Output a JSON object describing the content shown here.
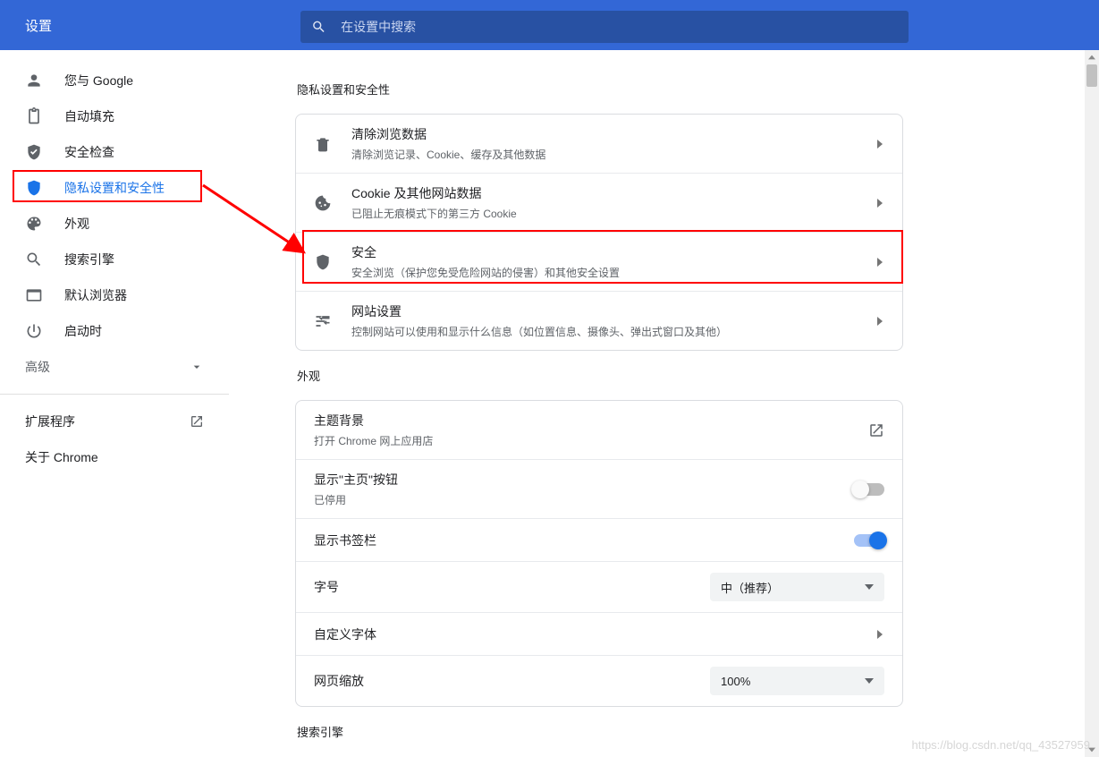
{
  "header": {
    "title": "设置"
  },
  "search": {
    "placeholder": "在设置中搜索"
  },
  "sidebar": {
    "items": [
      {
        "label": "您与 Google"
      },
      {
        "label": "自动填充"
      },
      {
        "label": "安全检查"
      },
      {
        "label": "隐私设置和安全性"
      },
      {
        "label": "外观"
      },
      {
        "label": "搜索引擎"
      },
      {
        "label": "默认浏览器"
      },
      {
        "label": "启动时"
      }
    ],
    "advanced": "高级",
    "extensions": "扩展程序",
    "about": "关于 Chrome"
  },
  "privacy": {
    "heading": "隐私设置和安全性",
    "rows": [
      {
        "title": "清除浏览数据",
        "sub": "清除浏览记录、Cookie、缓存及其他数据"
      },
      {
        "title": "Cookie 及其他网站数据",
        "sub": "已阻止无痕模式下的第三方 Cookie"
      },
      {
        "title": "安全",
        "sub": "安全浏览（保护您免受危险网站的侵害）和其他安全设置"
      },
      {
        "title": "网站设置",
        "sub": "控制网站可以使用和显示什么信息（如位置信息、摄像头、弹出式窗口及其他）"
      }
    ]
  },
  "appearance": {
    "heading": "外观",
    "theme": {
      "title": "主题背景",
      "sub": "打开 Chrome 网上应用店"
    },
    "homeButton": {
      "title": "显示\"主页\"按钮",
      "sub": "已停用"
    },
    "bookmarks": {
      "title": "显示书签栏"
    },
    "fontSize": {
      "title": "字号",
      "value": "中（推荐）"
    },
    "customFonts": {
      "title": "自定义字体"
    },
    "zoom": {
      "title": "网页缩放",
      "value": "100%"
    }
  },
  "searchEngine": {
    "heading": "搜索引擎"
  },
  "watermark": "https://blog.csdn.net/qq_43527959"
}
